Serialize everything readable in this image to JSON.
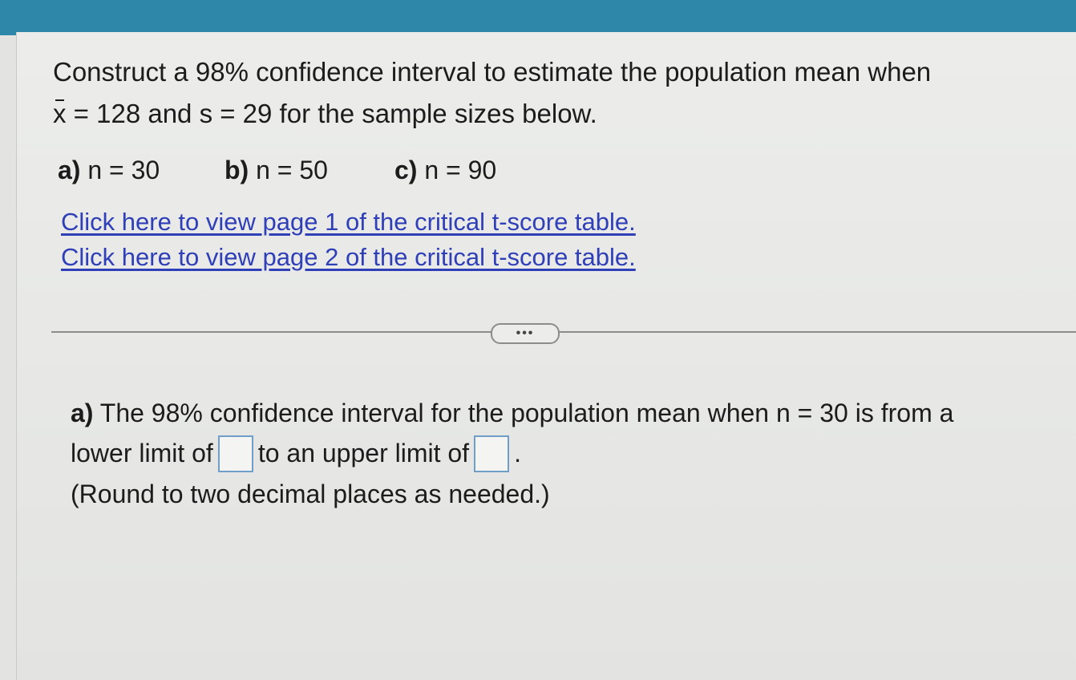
{
  "question": {
    "line1": "Construct a 98% confidence interval to estimate the population mean when",
    "xbar_symbol": "x",
    "line2_rest": " = 128 and s = 29 for the sample sizes below."
  },
  "parts": [
    {
      "label": "a)",
      "value": "n = 30"
    },
    {
      "label": "b)",
      "value": "n = 50"
    },
    {
      "label": "c)",
      "value": "n = 90"
    }
  ],
  "links": [
    "Click here to view page 1 of the critical t-score table.",
    "Click here to view page 2 of the critical t-score table."
  ],
  "more_button": "•••",
  "answer": {
    "label": "a)",
    "text1": " The 98% confidence interval for the population mean when n = 30 is from a",
    "text2": "lower limit of",
    "text3": "to an upper limit of",
    "text4": ".",
    "note": "(Round to two decimal places as needed.)",
    "lower_value": "",
    "upper_value": ""
  }
}
